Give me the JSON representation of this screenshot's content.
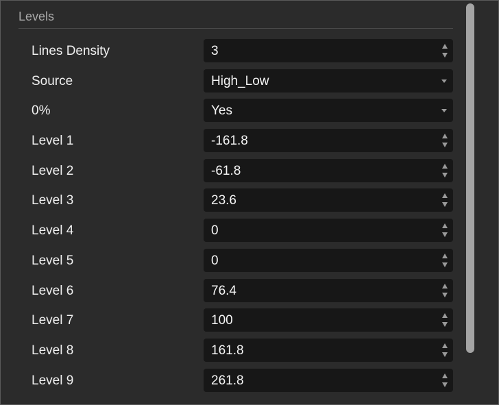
{
  "section": {
    "title": "Levels"
  },
  "rows": [
    {
      "label": "Lines Density",
      "value": "3",
      "control": "spinner"
    },
    {
      "label": "Source",
      "value": "High_Low",
      "control": "dropdown"
    },
    {
      "label": "0%",
      "value": "Yes",
      "control": "dropdown"
    },
    {
      "label": "Level 1",
      "value": "-161.8",
      "control": "spinner"
    },
    {
      "label": "Level 2",
      "value": "-61.8",
      "control": "spinner"
    },
    {
      "label": "Level 3",
      "value": "23.6",
      "control": "spinner"
    },
    {
      "label": "Level 4",
      "value": "0",
      "control": "spinner"
    },
    {
      "label": "Level 5",
      "value": "0",
      "control": "spinner"
    },
    {
      "label": "Level 6",
      "value": "76.4",
      "control": "spinner"
    },
    {
      "label": "Level 7",
      "value": "100",
      "control": "spinner"
    },
    {
      "label": "Level 8",
      "value": "161.8",
      "control": "spinner"
    },
    {
      "label": "Level 9",
      "value": "261.8",
      "control": "spinner"
    }
  ],
  "icons": {
    "spinner": "up-down-arrows-icon",
    "dropdown": "chevron-down-icon"
  },
  "colors": {
    "panel_background": "#2b2b2b",
    "field_background": "#171717",
    "label_text": "#f0f0f0",
    "header_text": "#a9a9a9",
    "scrollbar": "#a4a4a4"
  }
}
